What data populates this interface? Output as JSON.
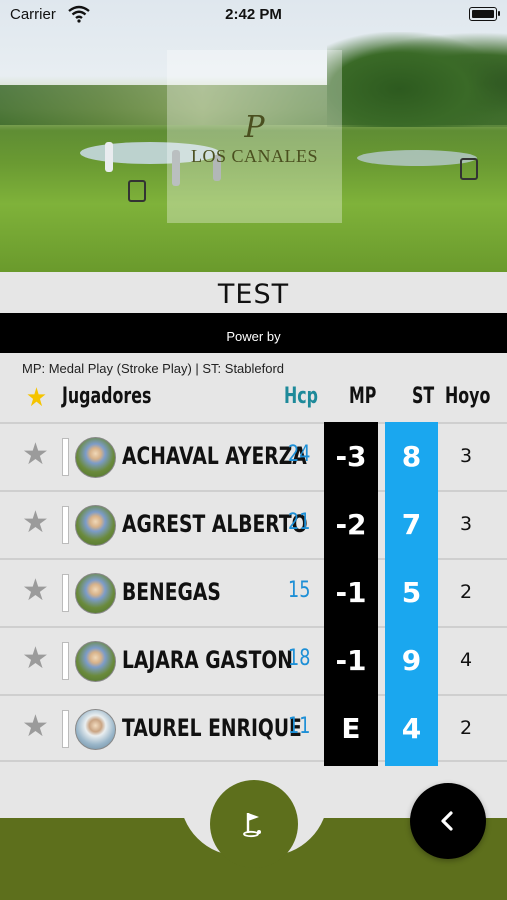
{
  "status_bar": {
    "carrier": "Carrier",
    "time": "2:42 PM"
  },
  "hero": {
    "logo_mark": "P",
    "logo_text": "LOS CANALES"
  },
  "title": "TEST",
  "powered_by": "Power by",
  "legend_text": "MP: Medal Play (Stroke Play) | ST: Stableford",
  "header": {
    "players": "Jugadores",
    "hcp": "Hcp",
    "mp": "MP",
    "st": "ST",
    "hoyo": "Hoyo"
  },
  "colors": {
    "accent_green": "#5d6f1c",
    "st_blue": "#1aa7ef",
    "hcp_blue": "#1d8fd6",
    "header_hcp": "#1e8a9a",
    "star_gold": "#f5c400"
  },
  "players": [
    {
      "name": "ACHAVAL AYERZA",
      "hcp": "24",
      "mp": "-3",
      "st": "8",
      "hoyo": "3"
    },
    {
      "name": "AGREST ALBERTO",
      "hcp": "21",
      "mp": "-2",
      "st": "7",
      "hoyo": "3"
    },
    {
      "name": "BENEGAS",
      "hcp": "15",
      "mp": "-1",
      "st": "5",
      "hoyo": "2"
    },
    {
      "name": "LAJARA GASTON",
      "hcp": "18",
      "mp": "-1",
      "st": "9",
      "hoyo": "4"
    },
    {
      "name": "TAUREL ENRIQUE",
      "hcp": "11",
      "mp": "E",
      "st": "4",
      "hoyo": "2"
    }
  ],
  "icons": {
    "header_star": "star-icon",
    "row_star": "star-outline-icon",
    "flag": "golf-flag-icon",
    "back": "chevron-left-icon"
  }
}
